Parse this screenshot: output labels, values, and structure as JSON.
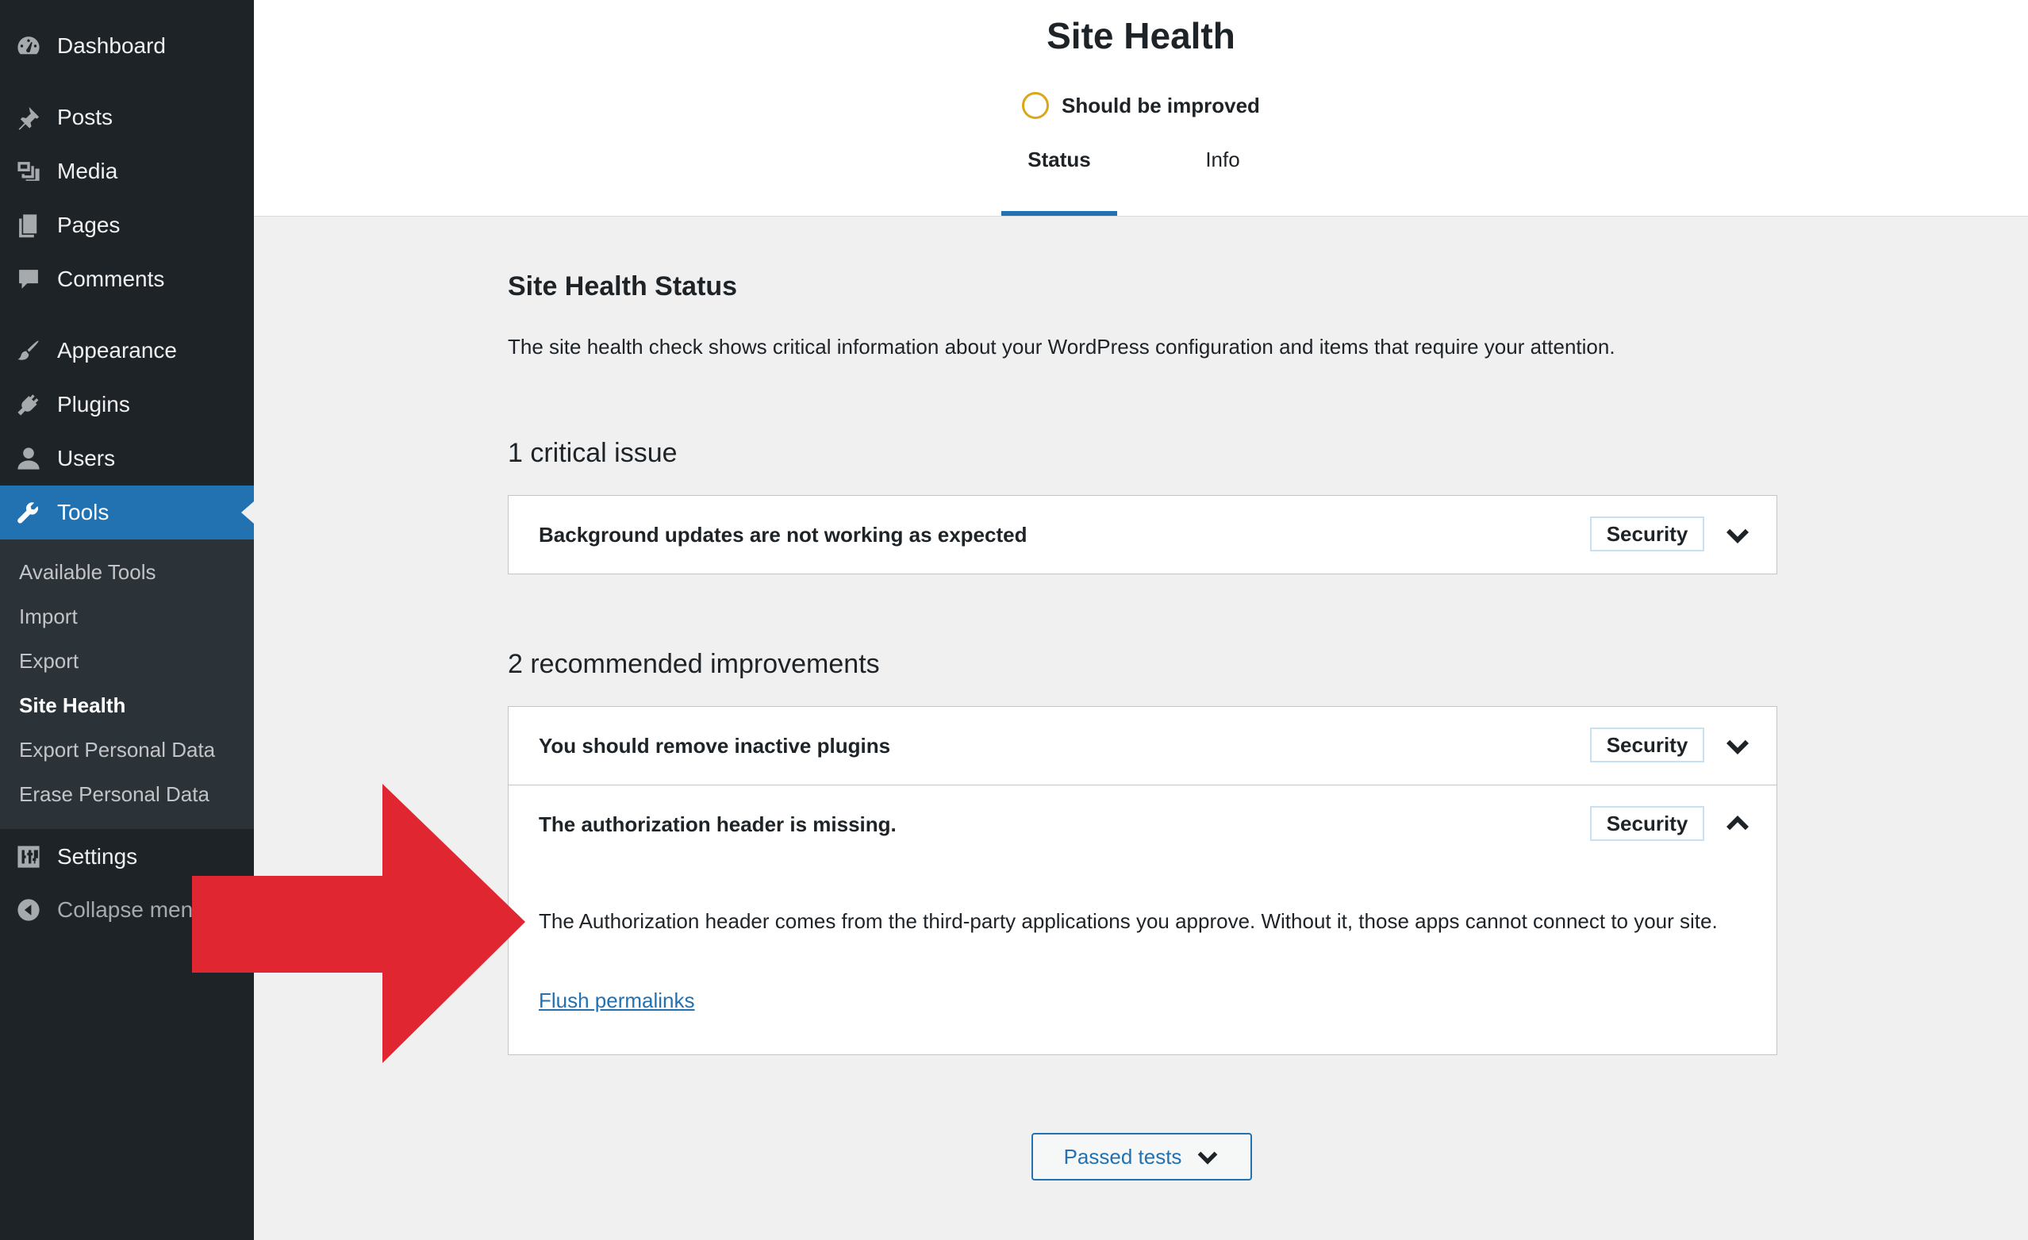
{
  "sidebar": {
    "items": [
      {
        "label": "Dashboard",
        "icon": "dashboard-icon"
      },
      {
        "label": "Posts",
        "icon": "pin-icon"
      },
      {
        "label": "Media",
        "icon": "media-icon"
      },
      {
        "label": "Pages",
        "icon": "pages-icon"
      },
      {
        "label": "Comments",
        "icon": "comment-icon"
      },
      {
        "label": "Appearance",
        "icon": "brush-icon"
      },
      {
        "label": "Plugins",
        "icon": "plug-icon"
      },
      {
        "label": "Users",
        "icon": "user-icon"
      },
      {
        "label": "Tools",
        "icon": "wrench-icon",
        "active": true
      },
      {
        "label": "Settings",
        "icon": "sliders-icon"
      },
      {
        "label": "Collapse menu",
        "icon": "collapse-arrow-icon"
      }
    ],
    "submenu": [
      {
        "label": "Available Tools"
      },
      {
        "label": "Import"
      },
      {
        "label": "Export"
      },
      {
        "label": "Site Health",
        "current": true
      },
      {
        "label": "Export Personal Data"
      },
      {
        "label": "Erase Personal Data"
      }
    ]
  },
  "header": {
    "title": "Site Health",
    "status_text": "Should be improved",
    "tabs": [
      {
        "label": "Status",
        "active": true
      },
      {
        "label": "Info"
      }
    ]
  },
  "main": {
    "heading": "Site Health Status",
    "description": "The site health check shows critical information about your WordPress configuration and items that require your attention.",
    "critical": {
      "title": "1 critical issue",
      "items": [
        {
          "title": "Background updates are not working as expected",
          "badge": "Security",
          "expanded": false
        }
      ]
    },
    "recommended": {
      "title": "2 recommended improvements",
      "items": [
        {
          "title": "You should remove inactive plugins",
          "badge": "Security",
          "expanded": false
        },
        {
          "title": "The authorization header is missing.",
          "badge": "Security",
          "expanded": true,
          "detail": "The Authorization header comes from the third-party applications you approve. Without it, those apps cannot connect to your site.",
          "link": "Flush permalinks"
        }
      ]
    },
    "passed_tests_label": "Passed tests"
  },
  "colors": {
    "sidebar_bg": "#1d2327",
    "active_blue": "#2271b1",
    "status_yellow": "#dba617",
    "badge_border": "#c5e1f2",
    "arrow_red": "#e02731"
  }
}
